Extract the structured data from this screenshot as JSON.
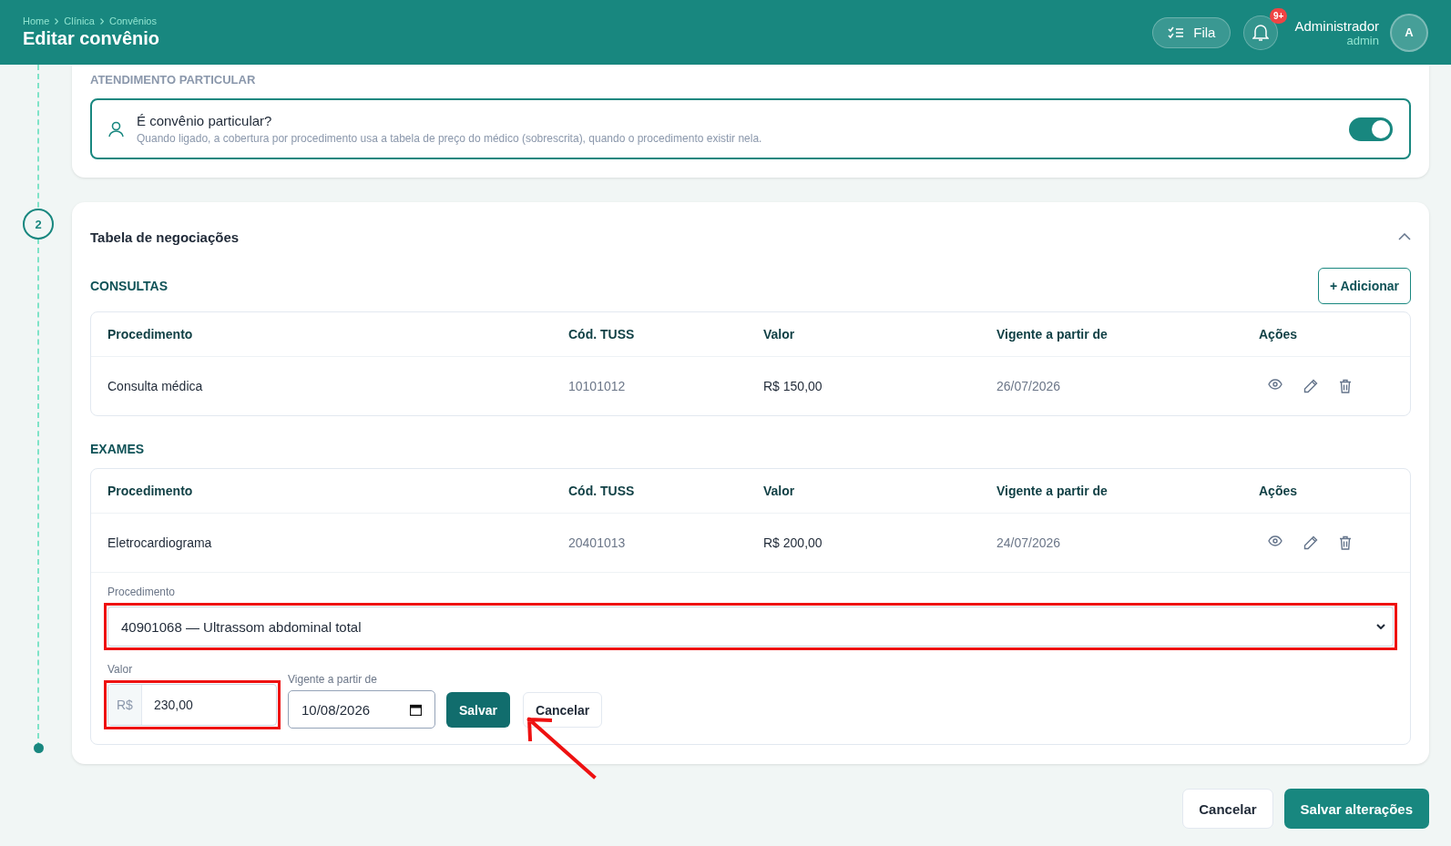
{
  "header": {
    "breadcrumbs": [
      "Home",
      "Clínica",
      "Convênios"
    ],
    "title": "Editar convênio",
    "queue_button": "Fila",
    "notification_badge": "9+",
    "user": {
      "name": "Administrador",
      "role": "admin",
      "initial": "A"
    }
  },
  "particular_section": {
    "heading": "ATENDIMENTO PARTICULAR",
    "toggle": {
      "label": "É convênio particular?",
      "hint": "Quando ligado, a cobertura por procedimento usa a tabela de preço do médico (sobrescrita), quando o procedimento existir nela.",
      "on": true
    }
  },
  "step": {
    "number": "2"
  },
  "negotiations": {
    "title": "Tabela de negociações",
    "expanded": true,
    "add_button": "+ Adicionar",
    "groups": [
      {
        "heading": "CONSULTAS",
        "columns": [
          "Procedimento",
          "Cód. TUSS",
          "Valor",
          "Vigente a partir de",
          "Ações"
        ],
        "rows": [
          {
            "procedure": "Consulta médica",
            "tuss": "10101012",
            "value": "R$ 150,00",
            "date": "26/07/2026"
          }
        ]
      },
      {
        "heading": "EXAMES",
        "columns": [
          "Procedimento",
          "Cód. TUSS",
          "Valor",
          "Vigente a partir de",
          "Ações"
        ],
        "rows": [
          {
            "procedure": "Eletrocardiograma",
            "tuss": "20401013",
            "value": "R$ 200,00",
            "date": "24/07/2026"
          }
        ]
      }
    ],
    "new_entry": {
      "procedure": {
        "label": "Procedimento",
        "value": "40901068 — Ultrassom abdominal total",
        "highlighted": true
      },
      "value": {
        "label": "Valor",
        "prefix": "R$",
        "value": "230,00",
        "highlighted": true
      },
      "date": {
        "label": "Vigente a partir de",
        "value": "10/08/2026"
      },
      "save_button": "Salvar",
      "cancel_button": "Cancelar",
      "pointer_arrow": true
    }
  },
  "footer": {
    "cancel_button": "Cancelar",
    "save_button": "Salvar alterações"
  }
}
